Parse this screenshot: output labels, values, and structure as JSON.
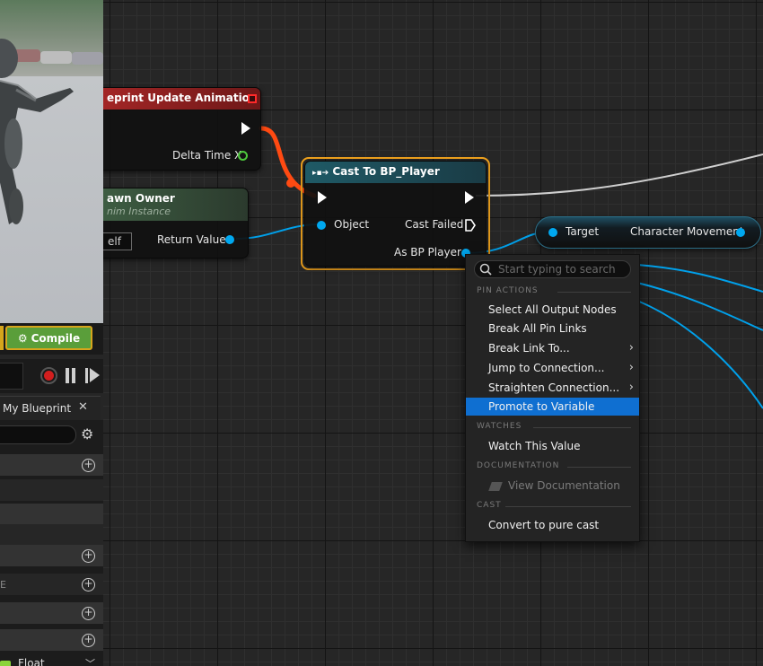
{
  "colors": {
    "exec": "#ffffff",
    "object_pin": "#00a8f0",
    "float_pin": "#4dc83c",
    "menu_highlight": "#0f6fd1",
    "compile_green": "#5a9e3a",
    "selection_orange": "#f0a31e"
  },
  "nodes": {
    "update_anim": {
      "title": "eprint Update Animation",
      "delta_label": "Delta Time X"
    },
    "pawn_owner": {
      "title": "awn Owner",
      "subtitle": "nim Instance",
      "self_label": "elf",
      "return_label": "Return Value"
    },
    "cast": {
      "title": "Cast To BP_Player",
      "object_label": "Object",
      "cast_failed_label": "Cast Failed",
      "as_player_label": "As BP Player"
    },
    "char_move": {
      "target_label": "Target",
      "output_label": "Character Movement"
    }
  },
  "left_panel": {
    "compile_label": "Compile",
    "my_blueprint_tab": "My Blueprint",
    "row_e_label": "E",
    "float_label": "Float"
  },
  "context_menu": {
    "search_placeholder": "Start typing to search",
    "sections": {
      "pin_actions": "PIN ACTIONS",
      "watches": "WATCHES",
      "documentation": "DOCUMENTATION",
      "cast": "CAST"
    },
    "items": {
      "select_all": "Select All Output Nodes",
      "break_all": "Break All Pin Links",
      "break_link": "Break Link To...",
      "jump": "Jump to Connection...",
      "straighten": "Straighten Connection...",
      "promote": "Promote to Variable",
      "watch": "Watch This Value",
      "view_doc": "View Documentation",
      "convert": "Convert to pure cast"
    },
    "highlighted": "Promote to Variable"
  }
}
